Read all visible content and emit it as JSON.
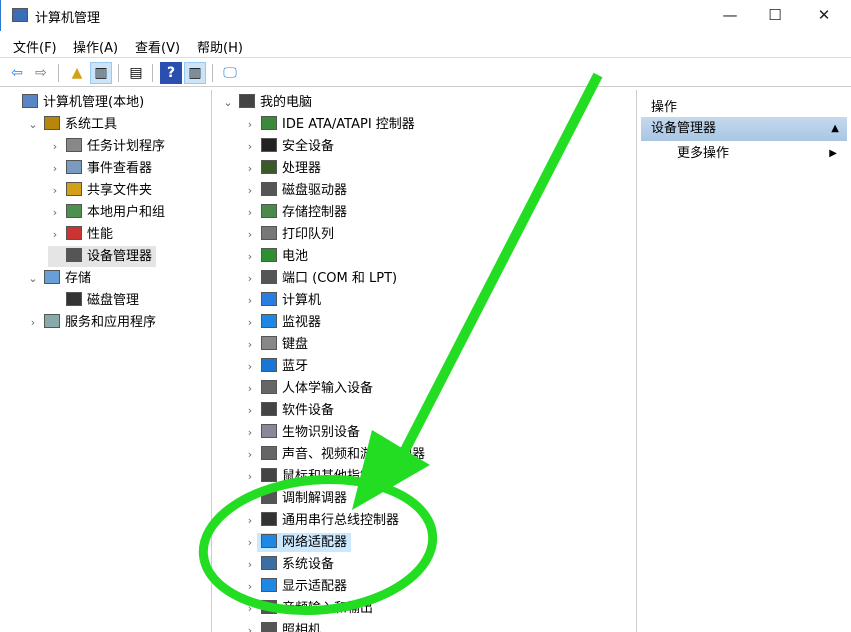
{
  "window": {
    "title": "计算机管理",
    "minimize": "—",
    "maximize": "☐",
    "close": "✕"
  },
  "menu": [
    "文件(F)",
    "操作(A)",
    "查看(V)",
    "帮助(H)"
  ],
  "toolbar": {
    "back": "⇦",
    "forward": "⇨",
    "up": "▲",
    "help": "?"
  },
  "left_tree": [
    {
      "label": "计算机管理(本地)",
      "level": 0,
      "chev": ""
    },
    {
      "label": "系统工具",
      "level": 1,
      "chev": "⌄"
    },
    {
      "label": "任务计划程序",
      "level": 2,
      "chev": "›"
    },
    {
      "label": "事件查看器",
      "level": 2,
      "chev": "›"
    },
    {
      "label": "共享文件夹",
      "level": 2,
      "chev": "›"
    },
    {
      "label": "本地用户和组",
      "level": 2,
      "chev": "›"
    },
    {
      "label": "性能",
      "level": 2,
      "chev": "›"
    },
    {
      "label": "设备管理器",
      "level": 2,
      "chev": "",
      "selected": true
    },
    {
      "label": "存储",
      "level": 1,
      "chev": "⌄"
    },
    {
      "label": "磁盘管理",
      "level": 2,
      "chev": ""
    },
    {
      "label": "服务和应用程序",
      "level": 1,
      "chev": "›"
    }
  ],
  "device_tree": {
    "root": "我的电脑",
    "items": [
      "IDE ATA/ATAPI 控制器",
      "安全设备",
      "处理器",
      "磁盘驱动器",
      "存储控制器",
      "打印队列",
      "电池",
      "端口 (COM 和 LPT)",
      "计算机",
      "监视器",
      "键盘",
      "蓝牙",
      "人体学输入设备",
      "软件设备",
      "生物识别设备",
      "声音、视频和游戏控制器",
      "鼠标和其他指针设备",
      "调制解调器",
      "通用串行总线控制器",
      "网络适配器",
      "系统设备",
      "显示适配器",
      "音频输入和输出",
      "照相机"
    ],
    "selected": "网络适配器"
  },
  "actions": {
    "header": "操作",
    "section": "设备管理器",
    "more": "更多操作"
  },
  "annotation_color": "#22dd22"
}
